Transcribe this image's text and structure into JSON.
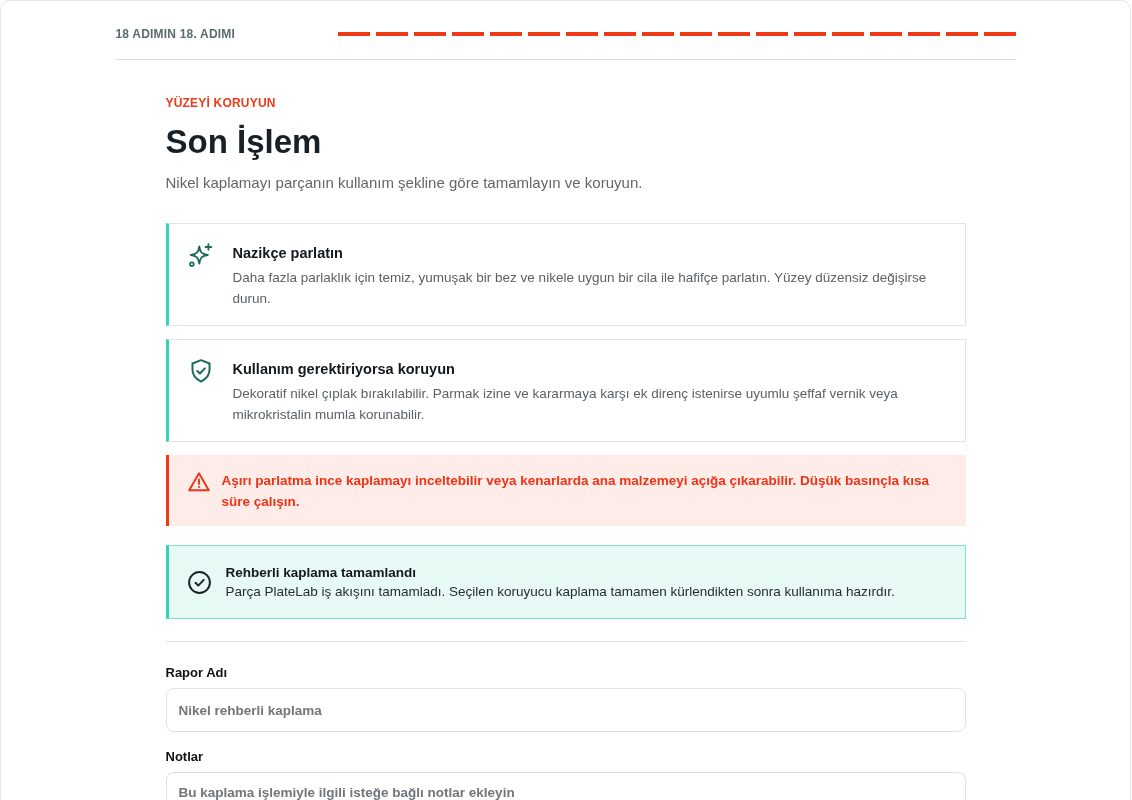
{
  "header": {
    "step_label": "18 ADIMIN 18. ADIMI",
    "progress_segments": [
      {
        "filled": true
      },
      {
        "filled": true
      },
      {
        "filled": true
      },
      {
        "filled": true
      },
      {
        "filled": true
      },
      {
        "filled": true
      },
      {
        "filled": true
      },
      {
        "filled": true
      },
      {
        "filled": true
      },
      {
        "filled": true
      },
      {
        "filled": true
      },
      {
        "filled": true
      },
      {
        "filled": true
      },
      {
        "filled": true
      },
      {
        "filled": true
      },
      {
        "filled": true
      },
      {
        "filled": true
      },
      {
        "filled": true
      }
    ]
  },
  "eyebrow": "YÜZEYİ KORUYUN",
  "title": "Son İşlem",
  "subtitle": "Nikel kaplamayı parçanın kullanım şekline göre tamamlayın ve koruyun.",
  "tips": [
    {
      "kind": "polish",
      "title": "Nazikçe parlatın",
      "text": "Daha fazla parlaklık için temiz, yumuşak bir bez ve nikele uygun bir cila ile hafifçe parlatın. Yüzey düzensiz değişirse durun."
    },
    {
      "kind": "protect",
      "title": "Kullanım gerektiriyorsa koruyun",
      "text": "Dekoratif nikel çıplak bırakılabilir. Parmak izine ve kararmaya karşı ek direnç istenirse uyumlu şeffaf vernik veya mikrokristalin mumla korunabilir."
    }
  ],
  "warning": {
    "text": "Aşırı parlatma ince kaplamayı inceltebilir veya kenarlarda ana malzemeyi açığa çıkarabilir. Düşük basınçla kısa süre çalışın."
  },
  "completion": {
    "title": "Rehberli kaplama tamamlandı",
    "text": "Parça PlateLab iş akışını tamamladı. Seçilen koruyucu kaplama tamamen kürlendikten sonra kullanıma hazırdır."
  },
  "form": {
    "fields": [
      {
        "kind": "input",
        "label": "Rapor Adı",
        "placeholder": "Nikel rehberli kaplama"
      },
      {
        "kind": "textarea",
        "label": "Notlar",
        "placeholder": "Bu kaplama işlemiyle ilgili isteğe bağlı notlar ekleyin"
      }
    ]
  }
}
